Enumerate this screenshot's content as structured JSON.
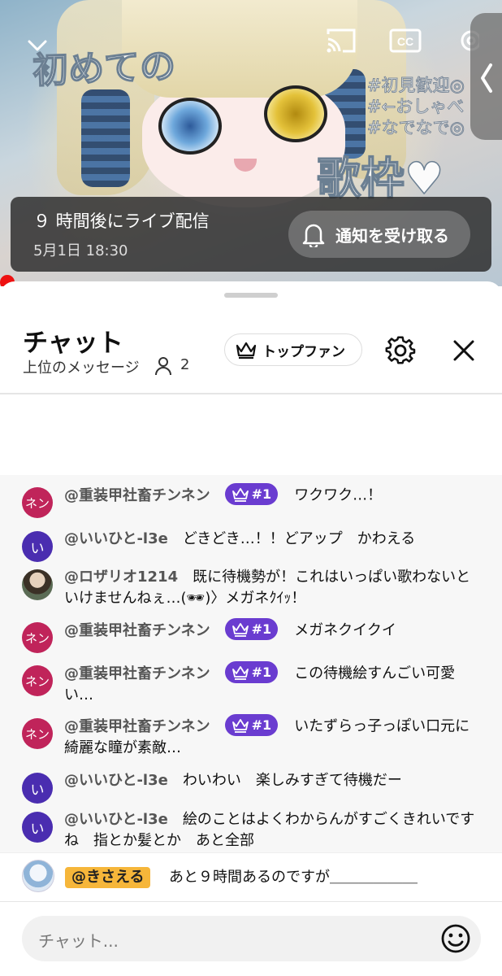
{
  "video": {
    "art_title": "初めての",
    "art_big_text": "歌枠♥",
    "hashtags": [
      "#初見歓迎◎",
      "#←おしゃべ",
      "#なでなで◎"
    ]
  },
  "upcoming": {
    "title": "９ 時間後にライブ配信",
    "datetime": "5月1日 18:30",
    "notify_label": "通知を受け取る"
  },
  "chat": {
    "title": "チャット",
    "mode": "上位のメッセージ",
    "viewer_count": "2",
    "top_fan_label": "トップファン",
    "input_placeholder": "チャット..."
  },
  "messages": [
    {
      "avatar_text": "ネン",
      "avatar_kind": "nen",
      "author": "@重装甲社畜チンネン",
      "badge": "#1",
      "text": "ワクワク…！"
    },
    {
      "avatar_text": "い",
      "avatar_kind": "ii",
      "author": "@いいひと-l3e",
      "badge": "",
      "text": "どきどき…！！どアップ　かわえる"
    },
    {
      "avatar_text": "",
      "avatar_kind": "photo",
      "author": "@ロザリオ1214",
      "badge": "",
      "text": "既に待機勢が！これはいっぱい歌わないといけませんねぇ…(🕶)〉メガネｸｲｯ！"
    },
    {
      "avatar_text": "ネン",
      "avatar_kind": "nen",
      "author": "@重装甲社畜チンネン",
      "badge": "#1",
      "text": "メガネクイクイ"
    },
    {
      "avatar_text": "ネン",
      "avatar_kind": "nen",
      "author": "@重装甲社畜チンネン",
      "badge": "#1",
      "text": "この待機絵すんごい可愛い…"
    },
    {
      "avatar_text": "ネン",
      "avatar_kind": "nen",
      "author": "@重装甲社畜チンネン",
      "badge": "#1",
      "text": "いたずらっ子っぽい口元に綺麗な瞳が素敵…"
    },
    {
      "avatar_text": "い",
      "avatar_kind": "ii",
      "author": "@いいひと-l3e",
      "badge": "",
      "text": "わいわい　楽しみすぎて待機だー"
    },
    {
      "avatar_text": "い",
      "avatar_kind": "ii",
      "author": "@いいひと-l3e",
      "badge": "",
      "text": "絵のことはよくわからんがすごくきれいですね　指とか髪とか　あと全部"
    }
  ],
  "pinned": {
    "author": "@きさえる",
    "text": "あと９時間あるのですが＿＿＿＿＿＿"
  },
  "colors": {
    "badge_purple": "#6a3cd0",
    "avatar_nen": "#c0245a",
    "avatar_ii": "#4a2db0",
    "pinned_highlight": "#f6b63a",
    "live_dot": "#ee1111"
  },
  "icons": [
    "chevron-down-icon",
    "cast-icon",
    "cc-icon",
    "gear-icon",
    "chevron-left-icon",
    "bell-icon",
    "crown-icon",
    "person-icon",
    "close-icon",
    "emoji-icon"
  ]
}
